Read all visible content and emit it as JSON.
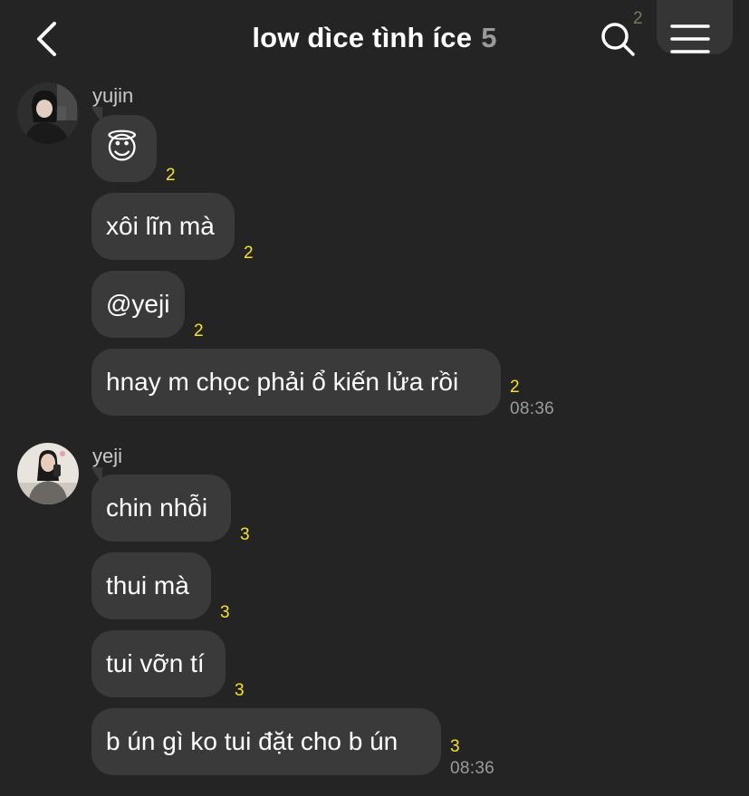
{
  "header": {
    "title": "low dìce tình íce",
    "member_count": "5",
    "back_icon": "chevron-left-icon",
    "search_icon": "search-icon",
    "menu_icon": "hamburger-menu-icon",
    "partial_message_count": "2"
  },
  "groups": [
    {
      "sender": "yujin",
      "messages": [
        {
          "text": "😇",
          "unread": "2"
        },
        {
          "text": "xôi lĩn mà",
          "unread": "2"
        },
        {
          "text": "@yeji",
          "unread": "2"
        },
        {
          "text": "hnay m chọc phải ổ kiến lửa rồi",
          "unread": "2",
          "time": "08:36"
        }
      ]
    },
    {
      "sender": "yeji",
      "messages": [
        {
          "text": "chin nhỗi",
          "unread": "3"
        },
        {
          "text": "thui mà",
          "unread": "3"
        },
        {
          "text": "tui vỡn tí",
          "unread": "3"
        },
        {
          "text": "b ún gì ko tui đặt cho b ún",
          "unread": "3",
          "time": "08:36"
        }
      ]
    }
  ],
  "colors": {
    "background": "#242424",
    "bubble": "#3a3a3a",
    "unread_count": "#f7e225",
    "timestamp": "#9b9b9b"
  }
}
